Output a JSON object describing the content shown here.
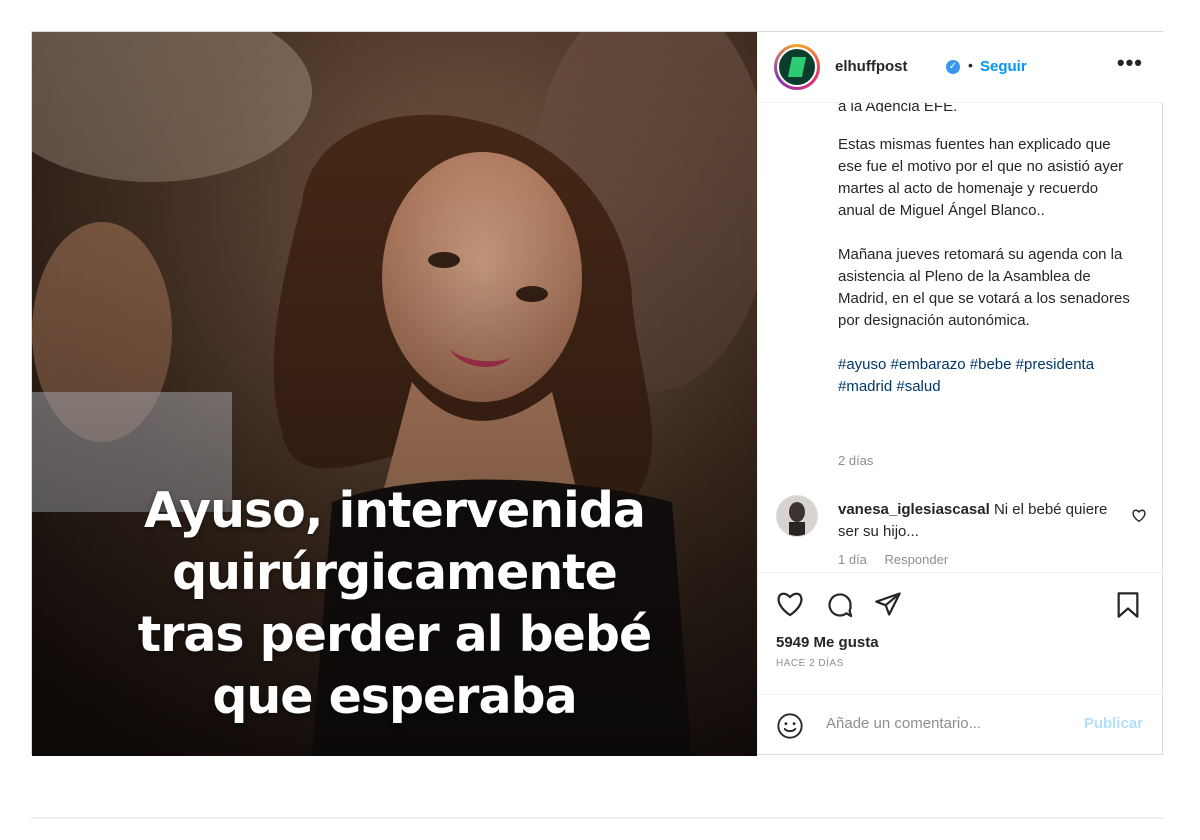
{
  "post": {
    "overlay_lines": [
      "Ayuso, intervenida",
      "quirúrgicamente",
      "tras perder al bebé",
      "que esperaba"
    ]
  },
  "header": {
    "username": "elhuffpost",
    "separator": "•",
    "follow_label": "Seguir",
    "more_label": "•••",
    "verified_icon": "verified-check-icon"
  },
  "caption": {
    "cut_line": "a la Agencia EFE.",
    "paragraphs": [
      "Estas mismas fuentes han explicado que ese fue el motivo por el que no asistió ayer martes al acto de homenaje y recuerdo anual de Miguel Ángel Blanco..",
      "Mañana jueves retomará su agenda con la asistencia al Pleno de la Asamblea de Madrid, en el que se votará a los senadores por designación autonómica."
    ],
    "hashtags": [
      "#ayuso",
      "#embarazo",
      "#bebe",
      "#presidenta",
      "#madrid",
      "#salud"
    ],
    "time": "2 días"
  },
  "comment": {
    "username": "vanesa_iglesiascasal",
    "text": "Ni el bebé quiere ser su hijo...",
    "time": "1 día",
    "reply_label": "Responder"
  },
  "actions": {
    "likes": "5949 Me gusta",
    "ago": "HACE 2 DÍAS",
    "icons": [
      "heart-icon",
      "comment-icon",
      "share-icon",
      "bookmark-icon"
    ]
  },
  "add_comment": {
    "placeholder": "Añade un comentario...",
    "publish_label": "Publicar"
  },
  "colors": {
    "accent": "#0095f6",
    "link": "#00376b",
    "muted": "#8e8e8e",
    "border": "#dbdbdb"
  }
}
